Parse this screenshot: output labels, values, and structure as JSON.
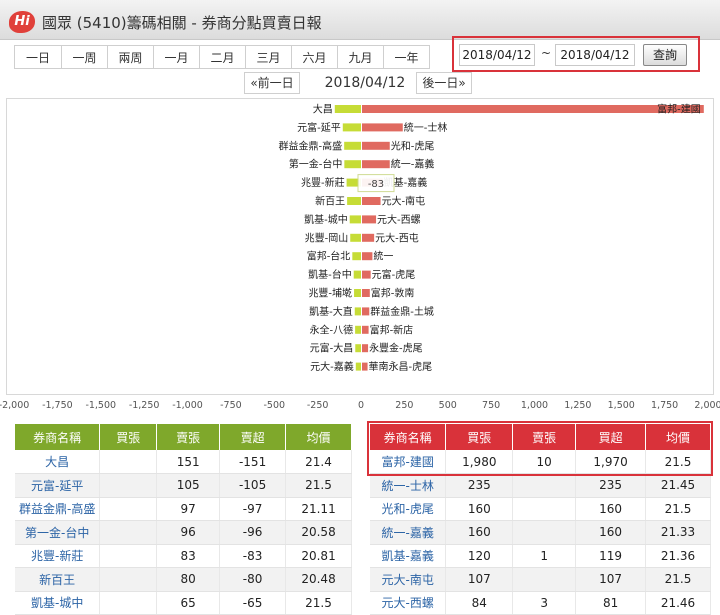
{
  "header": {
    "logo_text": "Hi",
    "title": "國眾 (5410)籌碼相關 - 券商分點買賣日報"
  },
  "range_buttons": [
    "一日",
    "一周",
    "兩周",
    "一月",
    "二月",
    "三月",
    "六月",
    "九月",
    "一年"
  ],
  "date_range": {
    "start": "2018/04/12",
    "separator": "~",
    "end": "2018/04/12",
    "query_label": "查詢"
  },
  "nav": {
    "prev_label": "«前一日",
    "current_date": "2018/04/12",
    "next_label": "後一日»"
  },
  "colors": {
    "buy_bar": "#c6dc36",
    "sell_bar": "#e06a60",
    "buy_header": "#7fa82b",
    "sell_header": "#d9323a",
    "highlight_border": "#d9323a"
  },
  "chart_data": {
    "type": "bar",
    "orientation": "horizontal",
    "xlim": [
      -2000,
      2000
    ],
    "x_ticks": [
      "-2,000",
      "-1,750",
      "-1,500",
      "-1,250",
      "-1,000",
      "-750",
      "-500",
      "-250",
      "0",
      "250",
      "500",
      "750",
      "1,000",
      "1,250",
      "1,500",
      "1,750",
      "2,000"
    ],
    "tooltip": "-83",
    "series": [
      {
        "labels": [
          "大昌",
          "元富-延平",
          "群益金鼎-高盛",
          "第一金-台中",
          "兆豐-新莊",
          "新百王",
          "凱基-城中",
          "兆豐-岡山",
          "富邦-台北",
          "凱基-台中",
          "兆豐-埔墘",
          "凱基-大直",
          "永全-八德",
          "元富-大昌",
          "元大-嘉義"
        ],
        "values": [
          -151,
          -105,
          -97,
          -96,
          -83,
          -80,
          -65,
          -62,
          -50,
          -42,
          -40,
          -36,
          -34,
          -33,
          -30
        ]
      },
      {
        "labels": [
          "富邦-建國",
          "統一-士林",
          "光和-虎尾",
          "統一-嘉義",
          "凱基-嘉義",
          "元大-南屯",
          "元大-西螺",
          "元大-西屯",
          "統一",
          "元富-虎尾",
          "富邦-敦南",
          "群益金鼎-土城",
          "富邦-新店",
          "永豐金-虎尾",
          "華南永昌-虎尾"
        ],
        "values": [
          1970,
          235,
          160,
          160,
          119,
          107,
          81,
          70,
          60,
          50,
          45,
          42,
          38,
          35,
          32
        ]
      }
    ]
  },
  "buy_table": {
    "headers": [
      "券商名稱",
      "買張",
      "賣張",
      "賣超",
      "均價"
    ],
    "rows": [
      [
        "大昌",
        "",
        "151",
        "-151",
        "21.4"
      ],
      [
        "元富-延平",
        "",
        "105",
        "-105",
        "21.5"
      ],
      [
        "群益金鼎-高盛",
        "",
        "97",
        "-97",
        "21.11"
      ],
      [
        "第一金-台中",
        "",
        "96",
        "-96",
        "20.58"
      ],
      [
        "兆豐-新莊",
        "",
        "83",
        "-83",
        "20.81"
      ],
      [
        "新百王",
        "",
        "80",
        "-80",
        "20.48"
      ],
      [
        "凱基-城中",
        "",
        "65",
        "-65",
        "21.5"
      ]
    ]
  },
  "sell_table": {
    "headers": [
      "券商名稱",
      "買張",
      "賣張",
      "買超",
      "均價"
    ],
    "rows": [
      [
        "富邦-建國",
        "1,980",
        "10",
        "1,970",
        "21.5"
      ],
      [
        "統一-士林",
        "235",
        "",
        "235",
        "21.45"
      ],
      [
        "光和-虎尾",
        "160",
        "",
        "160",
        "21.5"
      ],
      [
        "統一-嘉義",
        "160",
        "",
        "160",
        "21.33"
      ],
      [
        "凱基-嘉義",
        "120",
        "1",
        "119",
        "21.36"
      ],
      [
        "元大-南屯",
        "107",
        "",
        "107",
        "21.5"
      ],
      [
        "元大-西螺",
        "84",
        "3",
        "81",
        "21.46"
      ]
    ]
  }
}
